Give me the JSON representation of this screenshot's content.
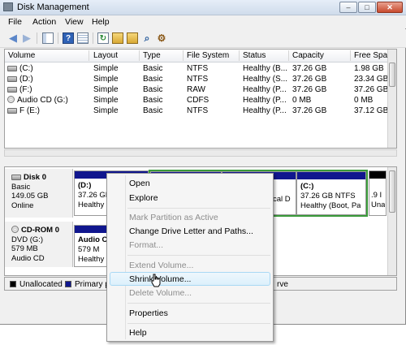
{
  "window": {
    "title": "Disk Management",
    "controls": {
      "minimize": "–",
      "maximize": "□",
      "close": "✕"
    }
  },
  "menu": {
    "items": [
      "File",
      "Action",
      "View",
      "Help"
    ]
  },
  "toolbar": {
    "icons": [
      "back-arrow-icon",
      "forward-arrow-icon",
      "show-hide-tree-icon",
      "help-icon",
      "properties-icon",
      "refresh-icon",
      "open-folder-icon",
      "new-folder-icon",
      "search-icon",
      "settings-icon"
    ]
  },
  "volume_list": {
    "columns": [
      "Volume",
      "Layout",
      "Type",
      "File System",
      "Status",
      "Capacity",
      "Free Spa..."
    ],
    "rows": [
      {
        "icon": "disk-icon",
        "volume": "(C:)",
        "layout": "Simple",
        "type": "Basic",
        "fs": "NTFS",
        "status": "Healthy (B...",
        "capacity": "37.26 GB",
        "free": "1.98 GB"
      },
      {
        "icon": "disk-icon",
        "volume": "(D:)",
        "layout": "Simple",
        "type": "Basic",
        "fs": "NTFS",
        "status": "Healthy (S...",
        "capacity": "37.26 GB",
        "free": "23.34 GB"
      },
      {
        "icon": "disk-icon",
        "volume": "(F:)",
        "layout": "Simple",
        "type": "Basic",
        "fs": "RAW",
        "status": "Healthy (P...",
        "capacity": "37.26 GB",
        "free": "37.26 GB"
      },
      {
        "icon": "cd-icon",
        "volume": "Audio CD (G:)",
        "layout": "Simple",
        "type": "Basic",
        "fs": "CDFS",
        "status": "Healthy (P...",
        "capacity": "0 MB",
        "free": "0 MB"
      },
      {
        "icon": "disk-icon",
        "volume": "F (E:)",
        "layout": "Simple",
        "type": "Basic",
        "fs": "NTFS",
        "status": "Healthy (P...",
        "capacity": "37.26 GB",
        "free": "37.12 GB"
      }
    ]
  },
  "graph": {
    "disk0": {
      "name": "Disk 0",
      "type": "Basic",
      "size": "149.05 GB",
      "state": "Online"
    },
    "disk0_partitions": [
      {
        "label": "(D:)",
        "size": "37.26 GB",
        "status": "Healthy"
      },
      {
        "label": "",
        "size": "",
        "status": "cal D"
      },
      {
        "label": "(C:)",
        "size": "37.26 GB NTFS",
        "status": "Healthy (Boot, Pa"
      },
      {
        "label": "",
        "size": ".9 I",
        "status": "Una"
      }
    ],
    "cdrom0": {
      "name": "CD-ROM 0",
      "type": "DVD (G:)",
      "size": "579 MB",
      "media": "Audio CD"
    },
    "cdrom0_partition": {
      "label": "Audio C",
      "size": "579 M",
      "status": "Healthy"
    }
  },
  "legend": {
    "unallocated": "Unallocated",
    "primary": "Primary parti",
    "trailing": "rve"
  },
  "colors": {
    "unallocated": "#000000",
    "primary": "#10168e",
    "logical_border": "#3a9a3a",
    "highlight": "#dcf0fb"
  },
  "context_menu": {
    "items": [
      {
        "label": "Open",
        "enabled": true
      },
      {
        "label": "Explore",
        "enabled": true
      },
      {
        "label": "Mark Partition as Active",
        "enabled": false
      },
      {
        "label": "Change Drive Letter and Paths...",
        "enabled": true
      },
      {
        "label": "Format...",
        "enabled": false
      },
      {
        "label": "Extend Volume...",
        "enabled": false
      },
      {
        "label": "Shrink Volume...",
        "enabled": true,
        "hovered": true
      },
      {
        "label": "Delete Volume...",
        "enabled": false
      },
      {
        "label": "Properties",
        "enabled": true
      },
      {
        "label": "Help",
        "enabled": true
      }
    ]
  }
}
